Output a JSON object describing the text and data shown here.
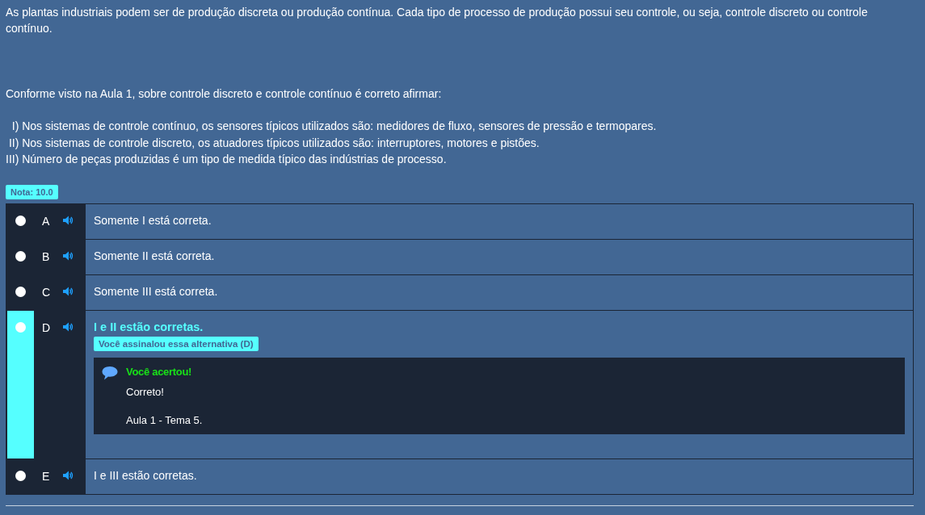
{
  "intro": "As plantas industriais podem ser de produção discreta ou produção contínua. Cada tipo de processo de produção possui seu controle, ou seja, controle discreto ou controle contínuo.",
  "question": "Conforme visto na Aula 1, sobre controle discreto e controle contínuo é correto afirmar:",
  "statements": [
    "  I) Nos sistemas de controle contínuo, os sensores típicos utilizados são: medidores de fluxo, sensores de pressão e termopares.",
    " II) Nos sistemas de controle discreto, os atuadores típicos utilizados são: interruptores, motores e pistões.",
    "III) Número de peças produzidas é um tipo de medida típico das indústrias de processo."
  ],
  "grade": "Nota: 10.0",
  "options": [
    {
      "letter": "A",
      "text": "Somente I está correta.",
      "selected": false,
      "checked": false
    },
    {
      "letter": "B",
      "text": "Somente II está correta.",
      "selected": false,
      "checked": false
    },
    {
      "letter": "C",
      "text": "Somente III está correta.",
      "selected": false,
      "checked": false
    },
    {
      "letter": "D",
      "text": "I e II estão corretas.",
      "selected": true,
      "checked": false,
      "marked_badge": "Você assinalou essa alternativa (D)",
      "feedback": {
        "title": "Você acertou!",
        "lines": [
          "Correto!",
          "Aula 1 - Tema 5."
        ]
      }
    },
    {
      "letter": "E",
      "text": "I e III estão corretas.",
      "selected": false,
      "checked": false
    }
  ]
}
